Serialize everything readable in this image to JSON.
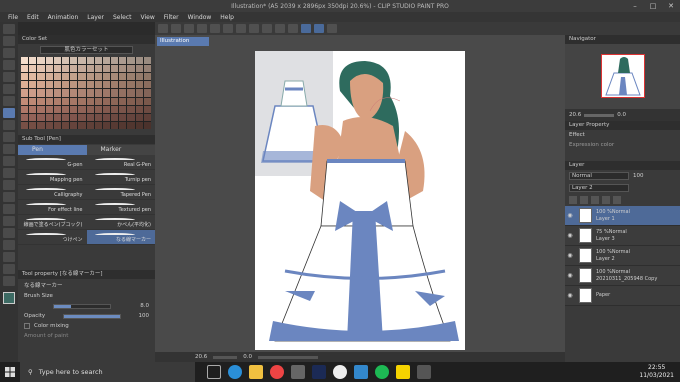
{
  "window": {
    "title": "Illustration* (A5 2039 x 2896px 350dpi 20.6%) - CLIP STUDIO PAINT PRO"
  },
  "menu": [
    "File",
    "Edit",
    "Animation",
    "Layer",
    "Select",
    "View",
    "Filter",
    "Window",
    "Help"
  ],
  "color_set": {
    "tab": "Color Set",
    "name": "肌色カラーセット"
  },
  "sub_tool": {
    "tab": "Sub Tool [Pen]",
    "tabs": [
      "Pen",
      "Marker"
    ],
    "brushes": [
      [
        "G-pen",
        "Real G-Pen"
      ],
      [
        "Mapping pen",
        "Turnip pen"
      ],
      [
        "Calligraphy",
        "Tapered Pen"
      ],
      [
        "For effect line",
        "Textured pen"
      ],
      [
        "線画で塗るペン(ブコック)",
        "かぺん(平均化)"
      ],
      [
        "つけペン",
        "なる線マーカー"
      ]
    ],
    "selected": "なる線マーカー"
  },
  "tool_property": {
    "tab": "Tool property [なる線マーカー]",
    "tool_name": "なる線マーカー",
    "brush_size_label": "Brush Size",
    "brush_size_value": "8.0",
    "opacity_label": "Opacity",
    "opacity_value": "100",
    "color_mixing_label": "Color mixing",
    "amount_of_paint_label": "Amount of paint"
  },
  "canvas": {
    "tab": "Illustration"
  },
  "status": {
    "zoom": "20.6",
    "angle": "0.0"
  },
  "navigator": {
    "tab": "Navigator",
    "zoom": "20.6",
    "angle": "0.0"
  },
  "layer_property": {
    "tab": "Layer Property",
    "effect_label": "Effect",
    "expression_label": "Expression color"
  },
  "layer_panel": {
    "tab": "Layer",
    "blend_mode": "Normal",
    "opacity": "100",
    "current": "Layer 2"
  },
  "layers": [
    {
      "opacity": "100 %Normal",
      "name": "Layer 1",
      "selected": true
    },
    {
      "opacity": "75 %Normal",
      "name": "Layer 3",
      "selected": false
    },
    {
      "opacity": "100 %Normal",
      "name": "Layer 2",
      "selected": false
    },
    {
      "opacity": "100 %Normal",
      "name": "20210311_205948 Copy",
      "selected": false
    },
    {
      "opacity": "",
      "name": "Paper",
      "selected": false
    }
  ],
  "taskbar": {
    "search_placeholder": "Type here to search",
    "time": "22:55",
    "date": "11/03/2021"
  },
  "colors": {
    "accent": "#5a7ab0",
    "dress_blue": "#6b86c0",
    "skin": "#d9a080",
    "hair": "#2e6b5e"
  }
}
